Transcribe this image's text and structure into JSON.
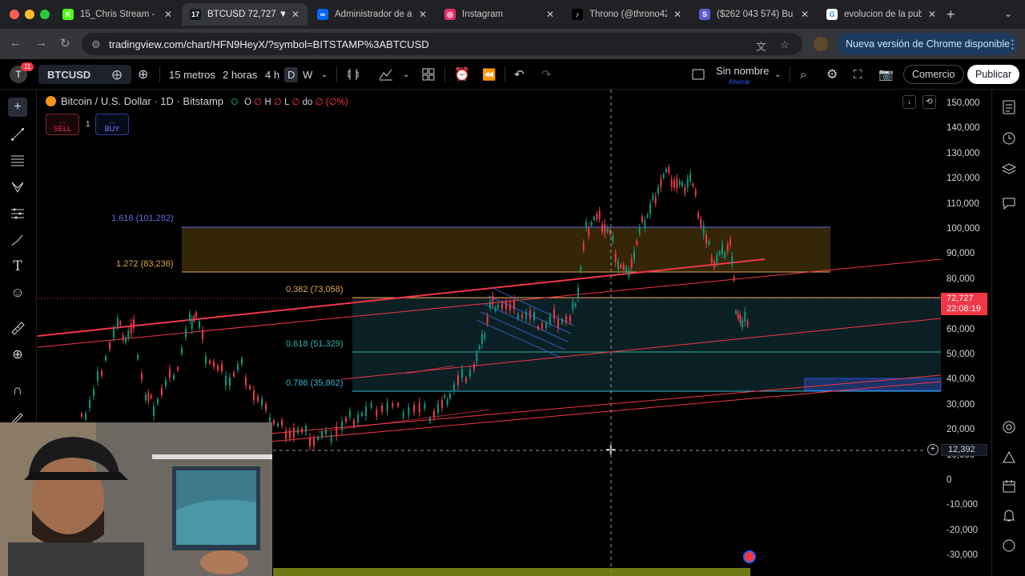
{
  "browser": {
    "tabs": [
      {
        "title": "15_Chris Stream - V",
        "favicon_color": "#53fc18",
        "favicon_glyph": "K",
        "active": false
      },
      {
        "title": "BTCUSD 72,727 ▼ -",
        "favicon_color": "#131722",
        "favicon_glyph": "17",
        "active": true
      },
      {
        "title": "Administrador de a",
        "favicon_color": "#0866ff",
        "favicon_glyph": "∞",
        "active": false
      },
      {
        "title": "Instagram",
        "favicon_color": "#e1306c",
        "favicon_glyph": "◎",
        "active": false
      },
      {
        "title": "Throno (@throno42",
        "favicon_color": "#000000",
        "favicon_glyph": "♪",
        "active": false
      },
      {
        "title": "($262 043 574) Bu",
        "favicon_color": "#5b5bd6",
        "favicon_glyph": "S",
        "active": false
      },
      {
        "title": "evolucion de la pub",
        "favicon_color": "#ffffff",
        "favicon_glyph": "G",
        "active": false
      }
    ],
    "new_tab_glyph": "+",
    "close_glyph": "✕",
    "url": "tradingview.com/chart/HFN9HeyX/?symbol=BITSTAMP%3ABTCUSD",
    "update_button": "Nueva versión de Chrome disponible"
  },
  "tv_toolbar": {
    "avatar_letter": "T",
    "avatar_badge": "11",
    "symbol": "BTCUSD",
    "timeframes": [
      "15 metros",
      "2 horas",
      "4 h",
      "D",
      "W"
    ],
    "layout_name": "Sin nombre",
    "layout_status": "Ahorrar",
    "trade_button": "Comercio",
    "publish_button": "Publicar"
  },
  "chart": {
    "legend": {
      "title": "Bitcoin / U.S. Dollar · 1D · Bitstamp",
      "ohlc": [
        {
          "k": "O",
          "v": "∅"
        },
        {
          "k": "H",
          "v": "∅"
        },
        {
          "k": "L",
          "v": "∅"
        },
        {
          "k": "do",
          "v": "∅ (∅%)"
        }
      ]
    },
    "sell_label": "SELL",
    "buy_label": "BUY",
    "sell_price": "...",
    "buy_price": "...",
    "quantity": "1",
    "fib_labels": [
      {
        "text": "1.618 (101,282)",
        "color": "#5b6ee1"
      },
      {
        "text": "1.272 (83,236)",
        "color": "#e0a94a"
      },
      {
        "text": "0.382 (73,058)",
        "color": "#e0a94a"
      },
      {
        "text": "0.618 (51,329)",
        "color": "#2fb5a8"
      },
      {
        "text": "0.786 (35,862)",
        "color": "#3ab5d9"
      }
    ],
    "y_axis": [
      "150,000",
      "140,000",
      "130,000",
      "120,000",
      "110,000",
      "100,000",
      "90,000",
      "80,000",
      "70,000",
      "60,000",
      "50,000",
      "40,000",
      "30,000",
      "20,000",
      "10,000",
      "0",
      "-10,000",
      "-20,000",
      "-30,000"
    ],
    "last_price": "72,727",
    "countdown": "22:08:19",
    "crosshair_price": "12,392",
    "colors": {
      "down": "#f23645",
      "up": "#089981",
      "fib_top_zone": "#3a2a08",
      "fib_bottom_zone": "#0d2a2e"
    }
  }
}
